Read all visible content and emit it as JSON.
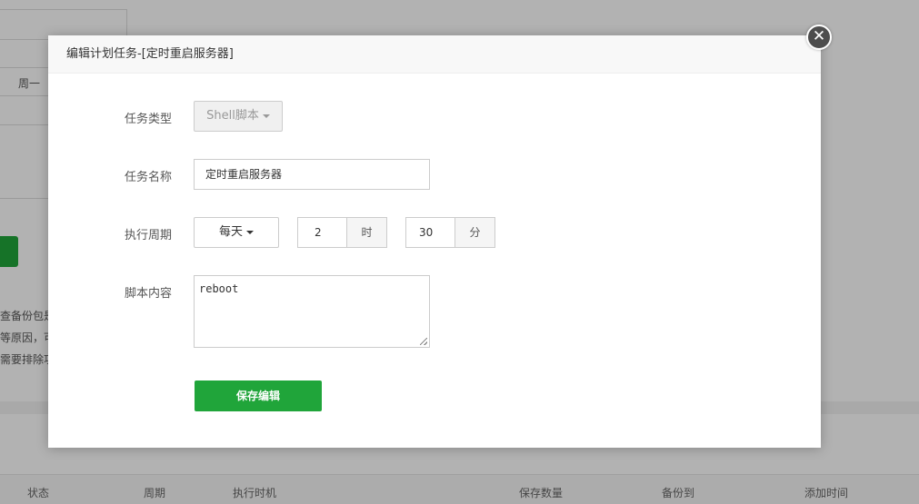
{
  "background": {
    "weekday_value": "周一",
    "notes": [
      "查备份包是",
      "等原因，可",
      "需要排除功"
    ],
    "table_headers": [
      "状态",
      "周期",
      "执行时机",
      "保存数量",
      "备份到",
      "添加时间"
    ]
  },
  "modal": {
    "title": "编辑计划任务-[定时重启服务器]",
    "close_icon": "✕",
    "task_type": {
      "label": "任务类型",
      "value": "Shell脚本"
    },
    "task_name": {
      "label": "任务名称",
      "value": "定时重启服务器"
    },
    "cycle": {
      "label": "执行周期",
      "period_value": "每天",
      "hour_value": "2",
      "hour_unit": "时",
      "minute_value": "30",
      "minute_unit": "分"
    },
    "script": {
      "label": "脚本内容",
      "value": "reboot"
    },
    "save_label": "保存编辑"
  },
  "colors": {
    "accent": "#20a53a",
    "overlay": "rgba(0,0,0,0.30)"
  }
}
